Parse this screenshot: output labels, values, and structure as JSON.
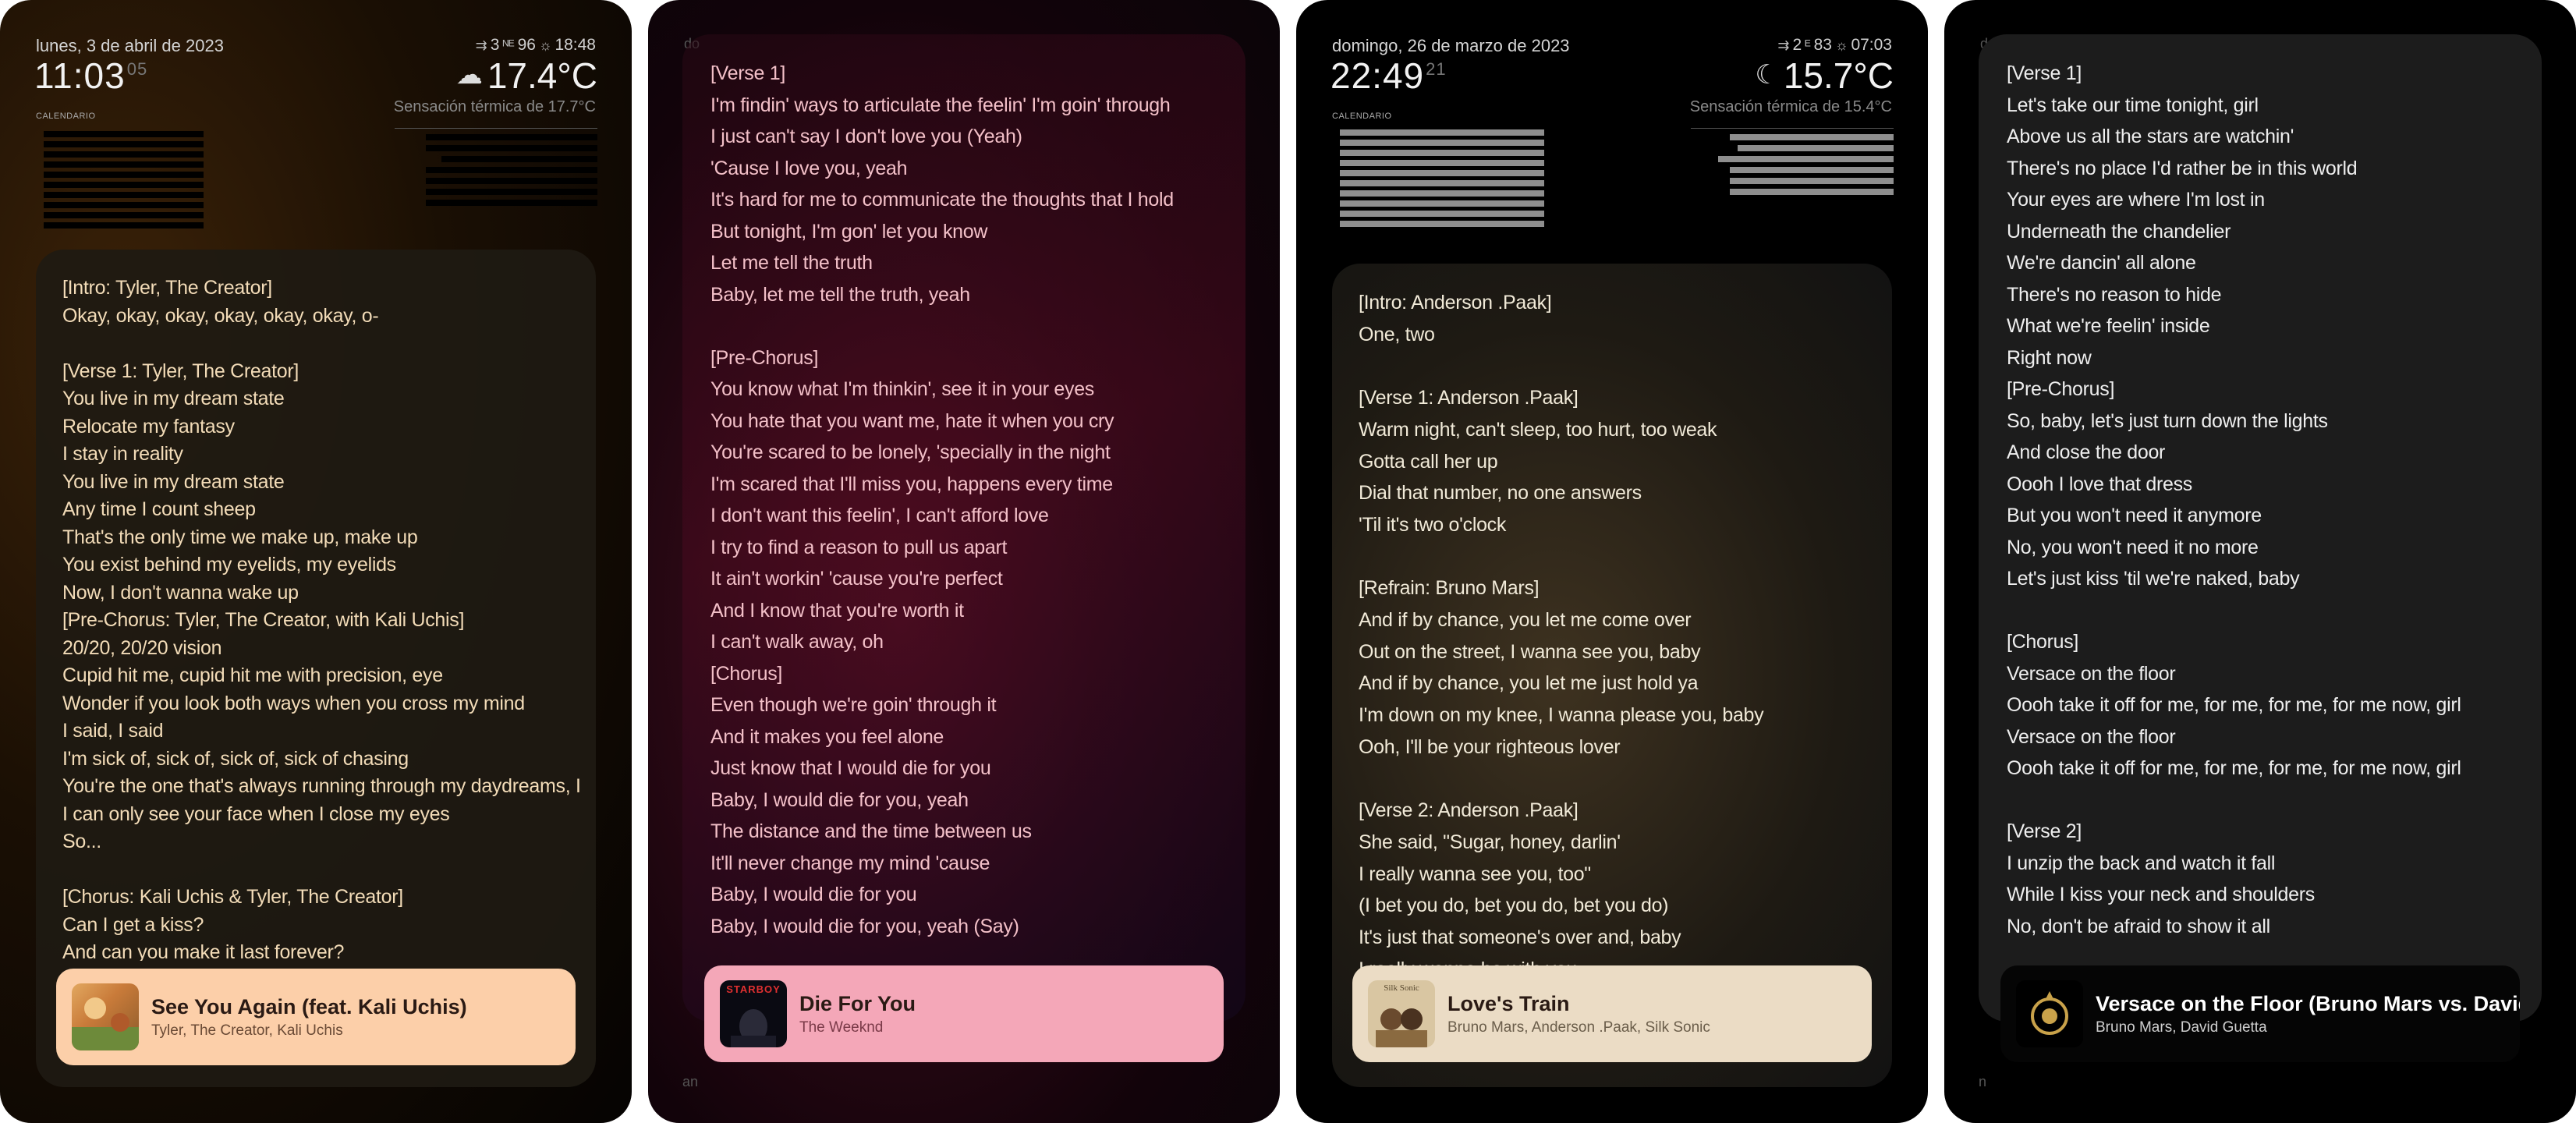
{
  "screens": [
    {
      "date": "lunes, 3 de abril de 2023",
      "time": "11:03",
      "seconds": "05",
      "status": {
        "signal": "3",
        "battery": "96",
        "sunrise": "18:48"
      },
      "temperature": "17.4°C",
      "feels_like": "Sensación térmica de 17.7°C",
      "calendar_label": "CALENDARIO",
      "weather_icon": "cloud-sun-icon",
      "lyrics": "[Intro: Tyler, The Creator]\nOkay, okay, okay, okay, okay, okay, o-\n\n[Verse 1: Tyler, The Creator]\nYou live in my dream state\nRelocate my fantasy\nI stay in reality\nYou live in my dream state\nAny time I count sheep\nThat's the only time we make up, make up\nYou exist behind my eyelids, my eyelids\nNow, I don't wanna wake up\n[Pre-Chorus: Tyler, The Creator, with Kali Uchis]\n20/20, 20/20 vision\nCupid hit me, cupid hit me with precision, eye\nWonder if you look both ways when you cross my mind\nI said, I said\nI'm sick of, sick of, sick of, sick of chasing\nYou're the one that's always running through my daydreams, I\nI can only see your face when I close my eyes\nSo...\n\n[Chorus: Kali Uchis & Tyler, The Creator]\nCan I get a kiss?\nAnd can you make it last forever?",
      "now_playing": {
        "title": "See You Again (feat. Kali Uchis)",
        "artist": "Tyler, The Creator, Kali Uchis"
      },
      "accent": "#fccfa9"
    },
    {
      "top_left": "do",
      "bottom_left": "an",
      "lyrics": "[Verse 1]\nI'm findin' ways to articulate the feelin' I'm goin' through\nI just can't say I don't love you (Yeah)\n'Cause I love you, yeah\nIt's hard for me to communicate the thoughts that I hold\nBut tonight, I'm gon' let you know\nLet me tell the truth\nBaby, let me tell the truth, yeah\n\n[Pre-Chorus]\nYou know what I'm thinkin', see it in your eyes\nYou hate that you want me, hate it when you cry\nYou're scared to be lonely, 'specially in the night\nI'm scared that I'll miss you, happens every time\nI don't want this feelin', I can't afford love\nI try to find a reason to pull us apart\nIt ain't workin' 'cause you're perfect\nAnd I know that you're worth it\nI can't walk away, oh\n[Chorus]\nEven though we're goin' through it\nAnd it makes you feel alone\nJust know that I would die for you\nBaby, I would die for you, yeah\nThe distance and the time between us\nIt'll never change my mind 'cause\nBaby, I would die for you\nBaby, I would die for you, yeah (Say)",
      "now_playing": {
        "title": "Die For You",
        "artist": "The Weeknd"
      },
      "art_label": "STARBOY",
      "accent": "#f4a7b8"
    },
    {
      "date": "domingo, 26 de marzo de 2023",
      "time": "22:49",
      "seconds": "21",
      "status": {
        "signal": "2",
        "battery": "83",
        "sunrise": "07:03"
      },
      "temperature": "15.7°C",
      "feels_like": "Sensación térmica de 15.4°C",
      "calendar_label": "CALENDARIO",
      "weather_icon": "moon-icon",
      "lyrics": "[Intro: Anderson .Paak]\nOne, two\n\n[Verse 1: Anderson .Paak]\nWarm night, can't sleep, too hurt, too weak\nGotta call her up\nDial that number, no one answers\n'Til it's two o'clock\n\n[Refrain: Bruno Mars]\nAnd if by chance, you let me come over\nOut on the street, I wanna see you, baby\nAnd if by chance, you let me just hold ya\nI'm down on my knee, I wanna please you, baby\nOoh, I'll be your righteous lover\n\n[Verse 2: Anderson .Paak]\nShe said, \"Sugar, honey, darlin'\nI really wanna see you, too\"\n(I bet you do, bet you do, bet you do)\nIt's just that someone's over and, baby\nI really wanna be with you",
      "now_playing": {
        "title": "Love's Train",
        "artist": "Bruno Mars, Anderson .Paak, Silk Sonic"
      },
      "art_label": "Silk Sonic",
      "accent": "#ebdcc5"
    },
    {
      "top_left": "d",
      "bottom_left": "n",
      "lyrics": "[Verse 1]\nLet's take our time tonight, girl\nAbove us all the stars are watchin'\nThere's no place I'd rather be in this world\nYour eyes are where I'm lost in\nUnderneath the chandelier\nWe're dancin' all alone\nThere's no reason to hide\nWhat we're feelin' inside\nRight now\n[Pre-Chorus]\nSo, baby, let's just turn down the lights\nAnd close the door\nOooh I love that dress\nBut you won't need it anymore\nNo, you won't need it no more\nLet's just kiss 'til we're naked, baby\n\n[Chorus]\nVersace on the floor\nOooh take it off for me, for me, for me, for me now, girl\nVersace on the floor\nOooh take it off for me, for me, for me, for me now, girl\n\n[Verse 2]\nI unzip the back and watch it fall\nWhile I kiss your neck and shoulders\nNo, don't be afraid to show it all\nI'll be right here ready to hold you",
      "now_playing": {
        "title": "Versace on the Floor (Bruno Mars vs. David Guetta)",
        "artist": "Bruno Mars, David Guetta"
      },
      "accent": "#050505"
    }
  ]
}
